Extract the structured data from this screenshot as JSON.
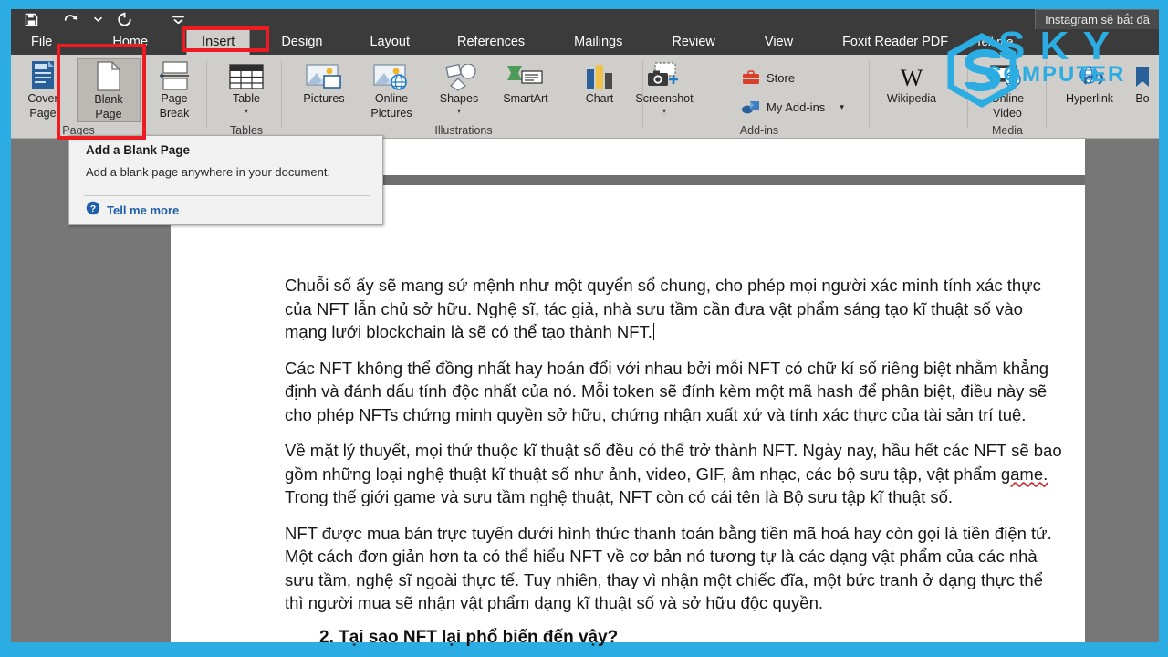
{
  "window": {
    "browser_tab_title": "Instagram sẽ bắt đầ"
  },
  "quick_access": {
    "items": [
      {
        "name": "save",
        "label": "Save",
        "icon": "save-icon"
      },
      {
        "name": "undo",
        "label": "Undo",
        "icon": "undo-icon"
      },
      {
        "name": "undo-dropdown",
        "label": "Undo options",
        "icon": "chevron-down-icon"
      },
      {
        "name": "repeat",
        "label": "Repeat",
        "icon": "repeat-icon"
      },
      {
        "name": "customize-qat",
        "label": "Customize Quick Access Toolbar",
        "icon": "chevron-down-icon"
      }
    ]
  },
  "ribbon": {
    "tabs": [
      {
        "label": "File",
        "active": false
      },
      {
        "label": "Home",
        "active": false
      },
      {
        "label": "Insert",
        "active": true
      },
      {
        "label": "Design",
        "active": false
      },
      {
        "label": "Layout",
        "active": false
      },
      {
        "label": "References",
        "active": false
      },
      {
        "label": "Mailings",
        "active": false
      },
      {
        "label": "Review",
        "active": false
      },
      {
        "label": "View",
        "active": false
      },
      {
        "label": "Foxit Reader PDF",
        "active": false
      }
    ],
    "tell_me": "Tell me",
    "groups": [
      {
        "name": "pages",
        "title": "Pages",
        "buttons": [
          {
            "label_line1": "Cover",
            "label_line2": "Page",
            "icon": "cover-page-icon",
            "has_dropdown": true,
            "selected": false
          },
          {
            "label_line1": "Blank",
            "label_line2": "Page",
            "icon": "blank-page-icon",
            "has_dropdown": false,
            "selected": true
          },
          {
            "label_line1": "Page",
            "label_line2": "Break",
            "icon": "page-break-icon",
            "has_dropdown": false,
            "selected": false
          }
        ]
      },
      {
        "name": "tables",
        "title": "Tables",
        "buttons": [
          {
            "label_line1": "Table",
            "label_line2": "",
            "icon": "table-icon",
            "has_dropdown": true,
            "selected": false
          }
        ]
      },
      {
        "name": "illustrations",
        "title": "Illustrations",
        "buttons": [
          {
            "label_line1": "Pictures",
            "label_line2": "",
            "icon": "pictures-icon",
            "has_dropdown": false,
            "selected": false
          },
          {
            "label_line1": "Online",
            "label_line2": "Pictures",
            "icon": "online-pictures-icon",
            "has_dropdown": false,
            "selected": false
          },
          {
            "label_line1": "Shapes",
            "label_line2": "",
            "icon": "shapes-icon",
            "has_dropdown": true,
            "selected": false
          },
          {
            "label_line1": "SmartArt",
            "label_line2": "",
            "icon": "smartart-icon",
            "has_dropdown": false,
            "selected": false
          },
          {
            "label_line1": "Chart",
            "label_line2": "",
            "icon": "chart-icon",
            "has_dropdown": false,
            "selected": false
          },
          {
            "label_line1": "Screenshot",
            "label_line2": "",
            "icon": "screenshot-icon",
            "has_dropdown": true,
            "selected": false
          }
        ]
      },
      {
        "name": "add-ins",
        "title": "Add-ins",
        "buttons": [
          {
            "label_line1": "Store",
            "icon": "store-icon"
          },
          {
            "label_line1": "My Add-ins",
            "icon": "my-addins-icon",
            "has_dropdown": true
          },
          {
            "label_line1": "Wikipedia",
            "icon": "wikipedia-icon"
          }
        ]
      },
      {
        "name": "media",
        "title": "Media",
        "buttons": [
          {
            "label_line1": "Online",
            "label_line2": "Video",
            "icon": "online-video-icon",
            "has_dropdown": false,
            "selected": false
          }
        ]
      },
      {
        "name": "links",
        "title": "",
        "buttons": [
          {
            "label_line1": "Hyperlink",
            "label_line2": "",
            "icon": "hyperlink-icon",
            "has_dropdown": false,
            "selected": false
          },
          {
            "label_line1": "Bo",
            "label_line2": "",
            "icon": "bookmark-icon",
            "has_dropdown": false,
            "selected": false
          }
        ]
      }
    ]
  },
  "tooltip": {
    "title": "Add a Blank Page",
    "body": "Add a blank page anywhere in your document.",
    "link": "Tell me more",
    "help_icon": "help-circle-icon"
  },
  "document": {
    "paragraphs": [
      "Chuỗi số ấy sẽ mang sứ mệnh như một quyển sổ chung, cho phép mọi người xác minh tính xác thực của NFT lẫn chủ sở hữu. Nghệ sĩ, tác giả, nhà sưu tầm cần đưa vật phẩm sáng tạo kĩ thuật số vào mạng lưới blockchain là sẽ có thể tạo thành NFT.",
      "Các NFT không thể đồng nhất hay hoán đổi với nhau bởi mỗi NFT có chữ kí số riêng biệt nhằm khẳng định và đánh dấu tính độc nhất của nó. Mỗi token sẽ đính kèm một mã hash để phân biệt, điều này sẽ cho phép NFTs chứng minh quyền sở hữu, chứng nhận xuất xứ và tính xác thực của tài sản trí tuệ.",
      "NFT được mua bán trực tuyến dưới hình thức thanh toán bằng tiền mã hoá hay còn gọi là tiền điện tử. Một cách đơn giản hơn ta có thể hiểu NFT về cơ bản nó tương tự là các dạng vật phẩm của các nhà sưu tầm, nghệ sĩ ngoài thực tế. Tuy nhiên, thay vì nhận một chiếc đĩa, một bức tranh ở dạng thực thể thì người mua sẽ nhận vật phẩm dạng kĩ thuật số và sở hữu độc quyền."
    ],
    "paragraph_with_spellcheck": {
      "before": "Về mặt lý thuyết, mọi thứ thuộc kĩ thuật số đều có thể trở thành NFT. Ngày nay, hầu hết các NFT sẽ bao gồm những loại nghệ thuật kĩ thuật số như ảnh, video, GIF, âm nhạc, các bộ sưu tập, vật phẩm ",
      "misspelled": "game.",
      "after": " Trong thế giới game và sưu tầm nghệ thuật, NFT còn có cái tên là Bộ sưu tập kĩ thuật số."
    },
    "heading": "2.  Tại sao NFT lại phổ biến đến vậy?"
  },
  "watermark": {
    "line1": "S K Y",
    "line2": "COMPUTER",
    "color": "#2bade3"
  },
  "annotations": {
    "highlight_color": "#ee1c22",
    "boxes": [
      {
        "name": "insert-tab-highlight"
      },
      {
        "name": "blank-page-highlight"
      }
    ]
  }
}
